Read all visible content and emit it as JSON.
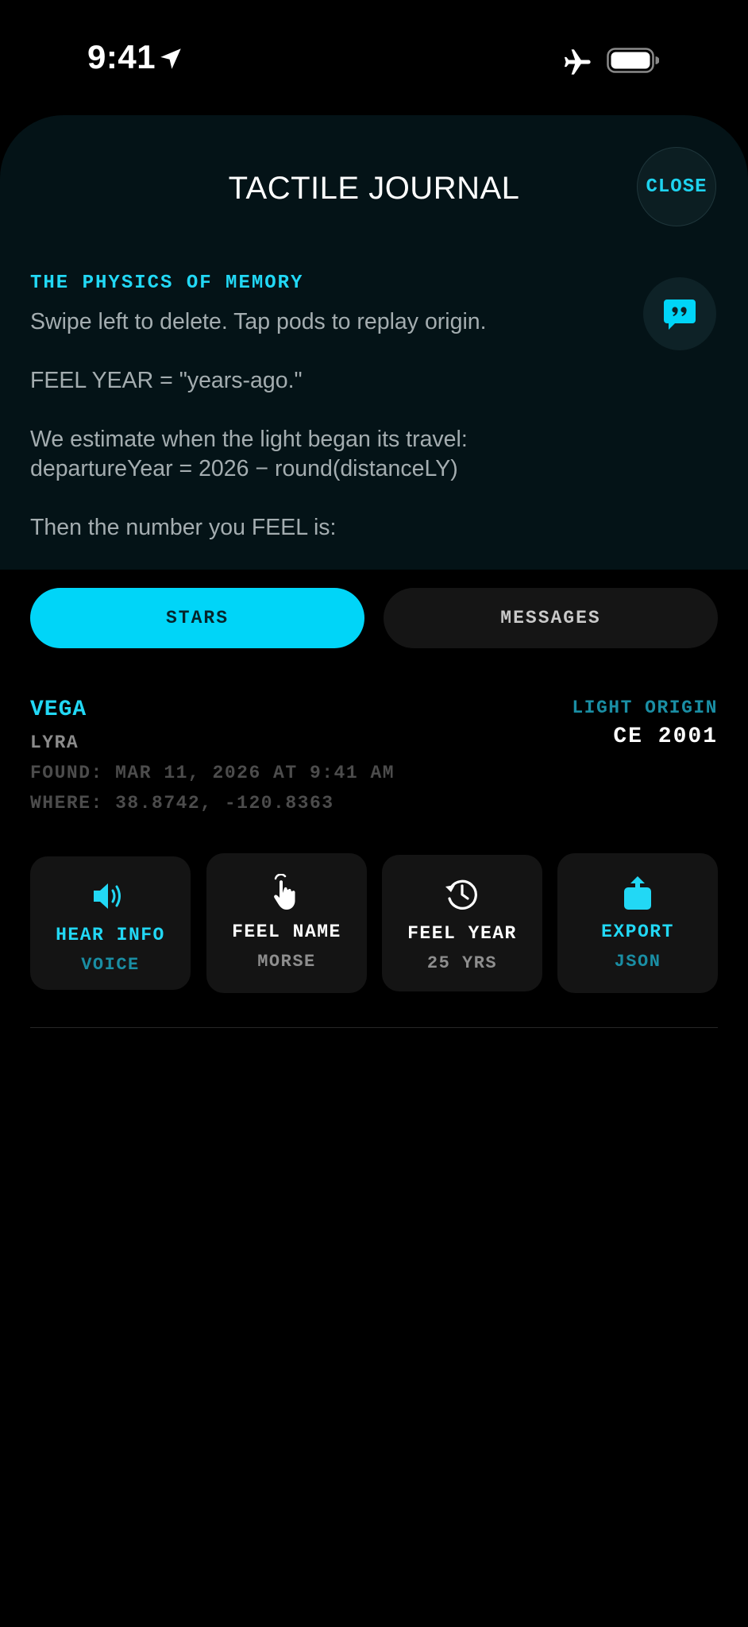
{
  "status_bar": {
    "time": "9:41",
    "icons": [
      "location-arrow-icon",
      "airplane-mode-icon",
      "battery-icon"
    ]
  },
  "sheet": {
    "title": "TACTILE JOURNAL",
    "close_label": "CLOSE",
    "section_heading": "THE PHYSICS OF MEMORY",
    "quote_icon": "speech-bubble-quote-icon",
    "body_lines": [
      "Swipe left to delete. Tap pods to replay origin.",
      "FEEL YEAR = \"years-ago.\"",
      "We estimate when the light began its travel:",
      "departureYear = 2026 − round(distanceLY)",
      "Then the number you FEEL is:"
    ]
  },
  "tabs": [
    {
      "label": "STARS",
      "active": true
    },
    {
      "label": "MESSAGES",
      "active": false
    }
  ],
  "entry": {
    "name": "VEGA",
    "constellation": "LYRA",
    "found": "FOUND: MAR 11, 2026 AT 9:41 AM",
    "where": "WHERE: 38.8742, -120.8363",
    "origin_label": "LIGHT ORIGIN",
    "origin_value": "CE 2001"
  },
  "pods": [
    {
      "title": "HEAR INFO",
      "subtitle": "VOICE",
      "icon": "speaker-icon"
    },
    {
      "title": "FEEL NAME",
      "subtitle": "MORSE",
      "icon": "hand-tap-icon"
    },
    {
      "title": "FEEL YEAR",
      "subtitle": "25 YRS",
      "icon": "history-clock-icon"
    },
    {
      "title": "EXPORT",
      "subtitle": "JSON",
      "icon": "share-upload-icon"
    }
  ],
  "colors": {
    "accent": "#00d5f8",
    "background": "#000000",
    "sheet": "#041317",
    "pod": "#141414"
  }
}
